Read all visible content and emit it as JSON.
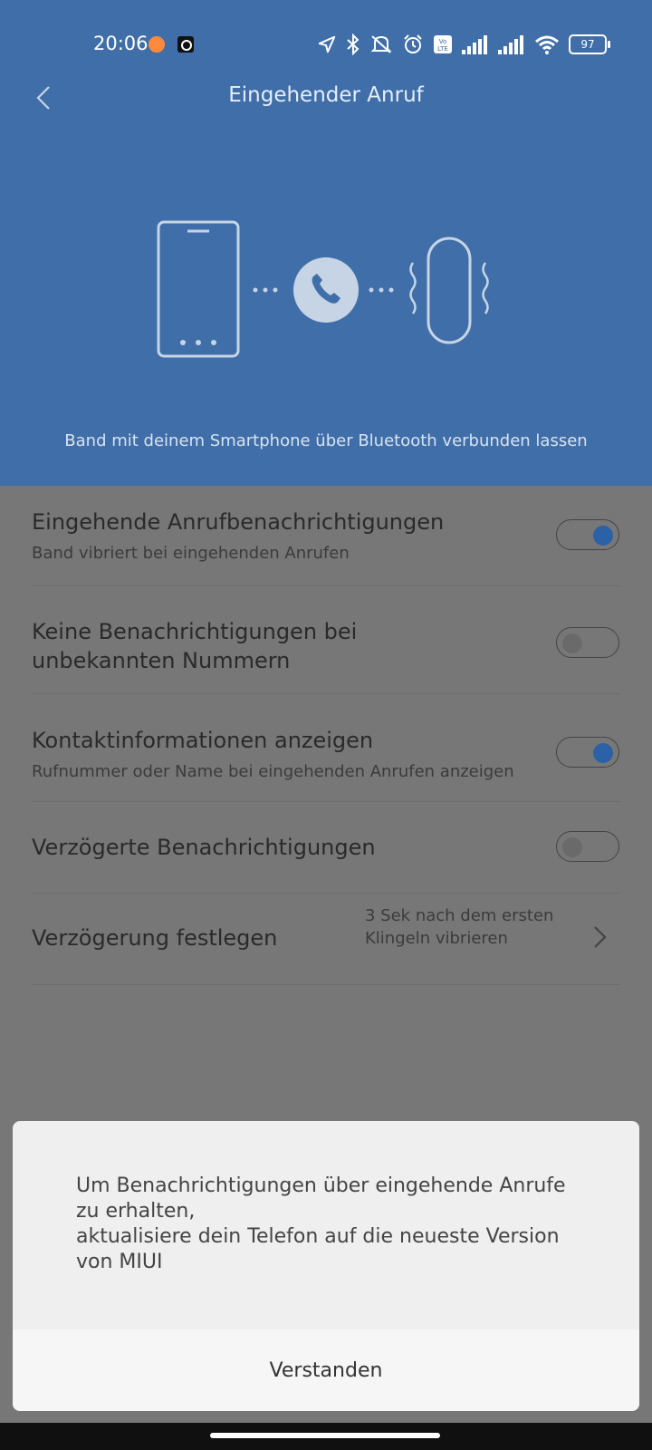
{
  "status_bar": {
    "time": "20:06",
    "battery": "97",
    "icons": [
      "orange-notification-icon",
      "camera-notification-icon",
      "location-arrow-icon",
      "bluetooth-icon",
      "mute-bell-icon",
      "alarm-clock-icon",
      "volte-icon",
      "signal-icon",
      "signal-icon",
      "wifi-icon",
      "battery-icon"
    ]
  },
  "header": {
    "title": "Eingehender Anruf",
    "hint": "Band mit deinem Smartphone über Bluetooth verbunden lassen"
  },
  "settings": [
    {
      "title": "Eingehende Anrufbenachrichtigungen",
      "subtitle": "Band vibriert bei eingehenden Anrufen",
      "on": true
    },
    {
      "title": "Keine Benachrichtigungen bei unbekannten Nummern",
      "on": false
    },
    {
      "title": "Kontaktinformationen anzeigen",
      "subtitle": "Rufnummer oder Name bei eingehenden Anrufen anzeigen",
      "on": true
    },
    {
      "title": "Verzögerte Benachrichtigungen",
      "on": false
    }
  ],
  "delay": {
    "title": "Verzögerung festlegen",
    "value": "3 Sek nach dem ersten Klingeln vibrieren"
  },
  "dialog": {
    "message": "Um Benachrichtigungen über eingehende Anrufe zu erhalten,\naktualisiere dein Telefon auf die neueste Version von MIUI",
    "button": "Verstanden"
  },
  "colors": {
    "header": "#3f6ea8",
    "accent": "#2b61a6",
    "overlay": "#777777"
  }
}
